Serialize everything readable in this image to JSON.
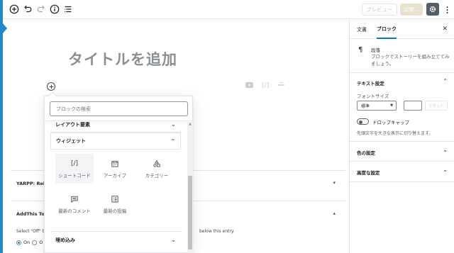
{
  "toolbar": {
    "preview_label": "プレビュー",
    "publish_label": "公開…"
  },
  "editor": {
    "title_placeholder": "タイトルを追加"
  },
  "inserter": {
    "search_placeholder": "ブロックの検索",
    "partial_panel_label": "レイアウト要素",
    "widgets_panel_label": "ウィジェット",
    "embeds_panel_label": "埋め込み",
    "blocks": [
      {
        "label": "ショートコード",
        "icon": "shortcode-icon"
      },
      {
        "label": "アーカイブ",
        "icon": "archive-icon"
      },
      {
        "label": "カテゴリー",
        "icon": "categories-icon"
      },
      {
        "label": "最新のコメント",
        "icon": "latest-comments-icon"
      },
      {
        "label": "最新の投稿",
        "icon": "latest-posts-icon"
      }
    ]
  },
  "metaboxes": {
    "yarpp_title": "YARPP: Rela",
    "addthis_title": "AddThis Too",
    "addthis_help": "Select \"Off\" t",
    "addthis_help_right": "below this entry.",
    "radio_on_label": "On",
    "radio_off_label": "O"
  },
  "sidebar": {
    "tab_document": "文書",
    "tab_block": "ブロック",
    "block_name": "段落",
    "block_description": "ブロックでストーリーを組み立ててみましょう。",
    "text_settings_title": "テキスト設定",
    "font_size_label": "フォントサイズ",
    "font_size_value": "標準",
    "reset_label": "リセット",
    "dropcap_label": "ドロップキャップ",
    "dropcap_help": "先頭文字を大きな表示に切り替えます。",
    "color_settings_title": "色の設定",
    "advanced_title": "高度な設定"
  },
  "colors": {
    "accent": "#007cba",
    "admin_bar": "#1f8ac7",
    "publish_disabled": "#e8e2cc"
  }
}
